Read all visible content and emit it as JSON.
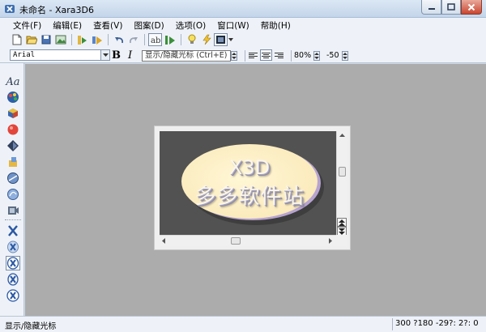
{
  "window": {
    "title": "未命名 - Xara3D6",
    "icon": "xara3d-app-icon",
    "controls": [
      "minimize-icon",
      "maximize-icon",
      "close-icon"
    ]
  },
  "menu": [
    {
      "label": "文件(F)"
    },
    {
      "label": "编辑(E)"
    },
    {
      "label": "查看(V)"
    },
    {
      "label": "图案(D)"
    },
    {
      "label": "选项(O)"
    },
    {
      "label": "窗口(W)"
    },
    {
      "label": "帮助(H)"
    }
  ],
  "toolbar": {
    "icons": [
      "new-file-icon",
      "open-folder-icon",
      "save-icon",
      "export-image-icon",
      "export-animation-icon",
      "play-icon",
      "undo-icon",
      "redo-icon",
      "text-options-icon",
      "animation-options-icon",
      "light-icon",
      "lightning-icon",
      "view-mode-icon"
    ]
  },
  "format_bar": {
    "font": "Arial",
    "bold_label": "B",
    "italic_label": "I",
    "tooltip": "显示/隐藏光标 (Ctrl+E)",
    "percent_label": "%",
    "zoom": "80%",
    "angle": "-50"
  },
  "left_tools": {
    "text_tool_label": "Aa",
    "icons": [
      "color-palette-icon",
      "extrude-icon",
      "bevel-icon",
      "shadow-icon",
      "light-direction-icon",
      "texture-icon",
      "sphere-icon",
      "camera-icon",
      "x-rotate-icon",
      "x-spin-icon",
      "x-swing-icon",
      "x-pulse-icon",
      "x-rock-icon"
    ]
  },
  "document": {
    "line1": "X3D",
    "line2": "多多软件站"
  },
  "colors": {
    "canvas_bg": "#acacac",
    "view_bg": "#525252",
    "ellipse_face": "#fbebbd",
    "ellipse_edge": "#b7a3d0"
  },
  "status": {
    "left": "显示/隐藏光标",
    "right": "300 ?180  -29?: 2?: 0"
  }
}
